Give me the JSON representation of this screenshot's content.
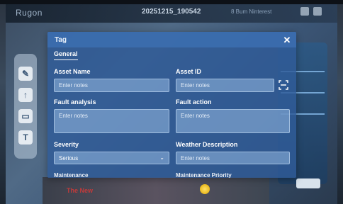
{
  "background": {
    "brand": "Rugon",
    "header_title": "20251215_190542",
    "header_right": "8 Bum Ninterest",
    "promo_text": "The New",
    "colors": {
      "modal": "#305c98",
      "field": "#96b9e1"
    }
  },
  "modal": {
    "title": "Tag",
    "close_icon": "close-icon",
    "section": "General",
    "fields": {
      "asset_name": {
        "label": "Asset Name",
        "placeholder": "Enter notes"
      },
      "asset_id": {
        "label": "Asset ID",
        "placeholder": "Enter notes"
      },
      "fault_analysis": {
        "label": "Fault analysis",
        "placeholder": "Enter notes"
      },
      "fault_action": {
        "label": "Fault action",
        "placeholder": "Enter notes"
      },
      "severity": {
        "label": "Severity",
        "value": "Serious"
      },
      "weather_description": {
        "label": "Weather Description",
        "placeholder": "Enter notes"
      },
      "maintenance": {
        "label": "Maintenance"
      },
      "maintenance_priority": {
        "label": "Maintenance Priority"
      }
    }
  }
}
